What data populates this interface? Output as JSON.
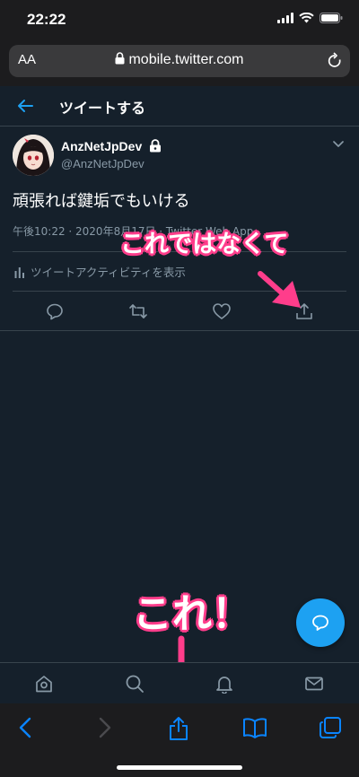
{
  "status": {
    "time": "22:22"
  },
  "browser": {
    "aa_label": "AA",
    "url": "mobile.twitter.com"
  },
  "header": {
    "title": "ツイートする"
  },
  "tweet": {
    "display_name": "AnzNetJpDev",
    "handle": "@AnzNetJpDev",
    "text": "頑張れば鍵垢でもいける",
    "meta": "午後10:22 · 2020年8月17日 · Twitter Web App",
    "activity": "ツイートアクティビティを表示"
  },
  "annotations": {
    "not_this": "これではなくて",
    "this_one": "これ！"
  },
  "colors": {
    "background": "#15202b",
    "accent": "#1da1f2",
    "annotation": "#ff3d8b",
    "safari_blue": "#0a84ff"
  },
  "icons": {
    "tweet_actions": [
      "reply-icon",
      "retweet-icon",
      "like-icon",
      "share-icon"
    ],
    "tabs": [
      "home-icon",
      "search-icon",
      "notifications-icon",
      "messages-icon"
    ],
    "safari": [
      "back-icon",
      "forward-icon",
      "share-icon",
      "bookmarks-icon",
      "tabs-icon"
    ]
  }
}
